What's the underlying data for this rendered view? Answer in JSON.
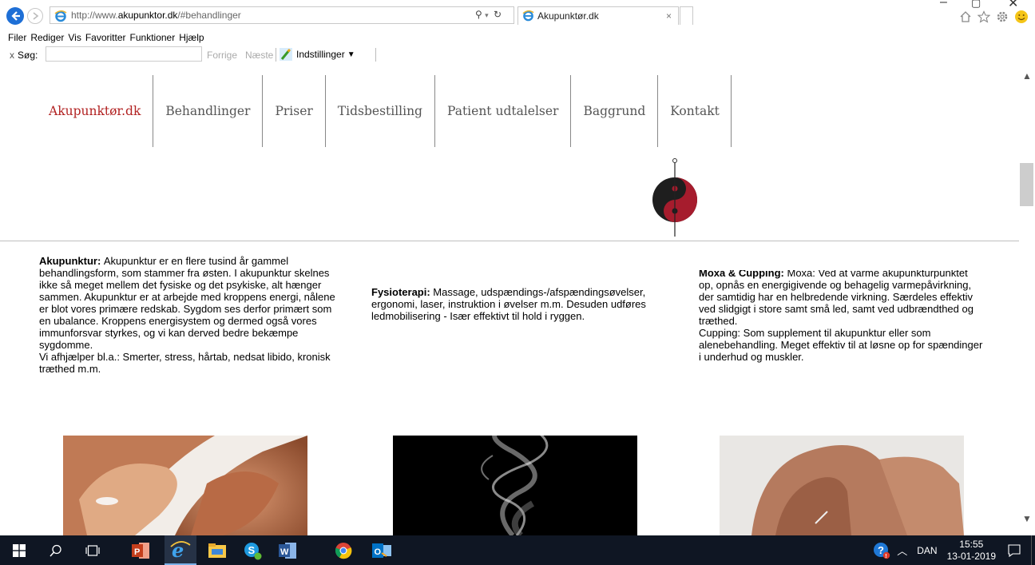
{
  "browser": {
    "url_prefix": "http://www.",
    "url_domain": "akupunktor.dk",
    "url_path": "/#behandlinger",
    "tab_title": "Akupunktør.dk",
    "tab_close": "×",
    "menu": [
      "Filer",
      "Rediger",
      "Vis",
      "Favoritter",
      "Funktioner",
      "Hjælp"
    ],
    "find": {
      "close": "x",
      "label": "Søg:",
      "value": "",
      "prev": "Forrige",
      "next": "Næste",
      "options": "Indstillinger"
    }
  },
  "site": {
    "nav": [
      "Akupunktør.dk",
      "Behandlinger",
      "Priser",
      "Tidsbestilling",
      "Patient udtalelser",
      "Baggrund",
      "Kontakt"
    ],
    "columns": [
      {
        "heading": "Akupunktur:",
        "text": "Akupunktur er en flere tusind år gammel behandlingsform, som stammer fra østen. I akupunktur skelnes ikke så meget mellem det fysiske og det psykiske, alt hænger sammen. Akupunktur er at arbejde med kroppens energi, nålene er blot vores primære redskab. Sygdom ses derfor primært som en ubalance. Kroppens energisystem og dermed også vores immunforsvar styrkes, og vi kan derved bedre bekæmpe sygdomme.",
        "text2": "Vi afhjælper bl.a.: Smerter, stress, hårtab, nedsat libido, kronisk træthed m.m."
      },
      {
        "heading": "Fysioterapi:",
        "text": "Massage, udspændings-/afspændingsøvelser, ergonomi, laser, instruktion i øvelser m.m. Desuden udføres ledmobilisering - Især effektivt til hold i ryggen."
      },
      {
        "heading": "Moxa & Cupping:",
        "text": "Moxa: Ved at varme akupunkturpunktet op, opnås en energigivende og behagelig varmepåvirkning, der samtidig har en helbredende virkning. Særdeles effektiv ved slidgigt i store samt små led, samt ved udbrændthed og træthed.",
        "text2": "Cupping: Som supplement til akupunktur eller som alenebehandling. Meget effektiv til at løsne op for spændinger i underhud og muskler."
      }
    ]
  },
  "taskbar": {
    "language": "DAN",
    "time": "15:55",
    "date": "13-01-2019"
  },
  "colors": {
    "brand_red": "#b22222",
    "nav_text": "#555555",
    "taskbar_bg": "#0f1623",
    "ie_blue": "#1e6fd6"
  }
}
